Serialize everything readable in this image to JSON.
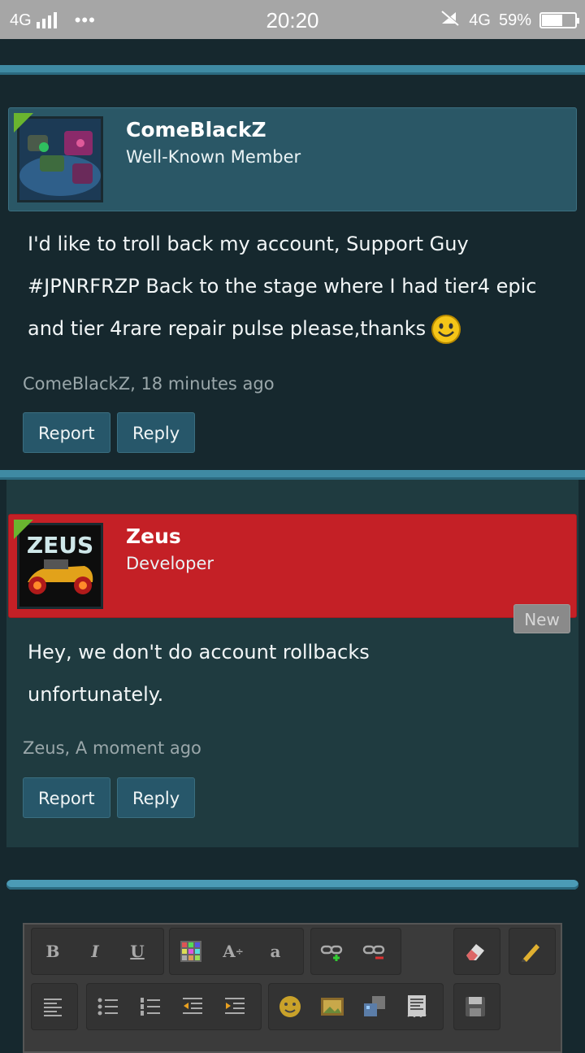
{
  "status_bar": {
    "network": "4G",
    "more": "•••",
    "time": "20:20",
    "network_right": "4G",
    "battery_percent": "59%",
    "battery_level": 0.59
  },
  "posts": [
    {
      "author": "ComeBlackZ",
      "role": "Well-Known Member",
      "message": "I'd like to troll back my account, Support Guy #JPNRFRZP Back to the stage where I had tier4 epic and tier 4rare repair pulse please,thanks",
      "meta": "ComeBlackZ, 18 minutes ago",
      "report_label": "Report",
      "reply_label": "Reply"
    },
    {
      "author": "Zeus",
      "avatar_text": "ZEUS",
      "role": "Developer",
      "badge": "New",
      "message_line1": "Hey, we don't do account rollbacks",
      "message_line2": "unfortunately.",
      "meta": "Zeus, A moment ago",
      "report_label": "Report",
      "reply_label": "Reply"
    }
  ],
  "editor": {
    "bold": "B",
    "italic": "I",
    "underline": "U",
    "font_size": "A",
    "font": "a"
  },
  "colors": {
    "member_box": "#2a5766",
    "developer_box": "#c42026",
    "button": "#27576a",
    "rule": "#3f8aa3"
  }
}
